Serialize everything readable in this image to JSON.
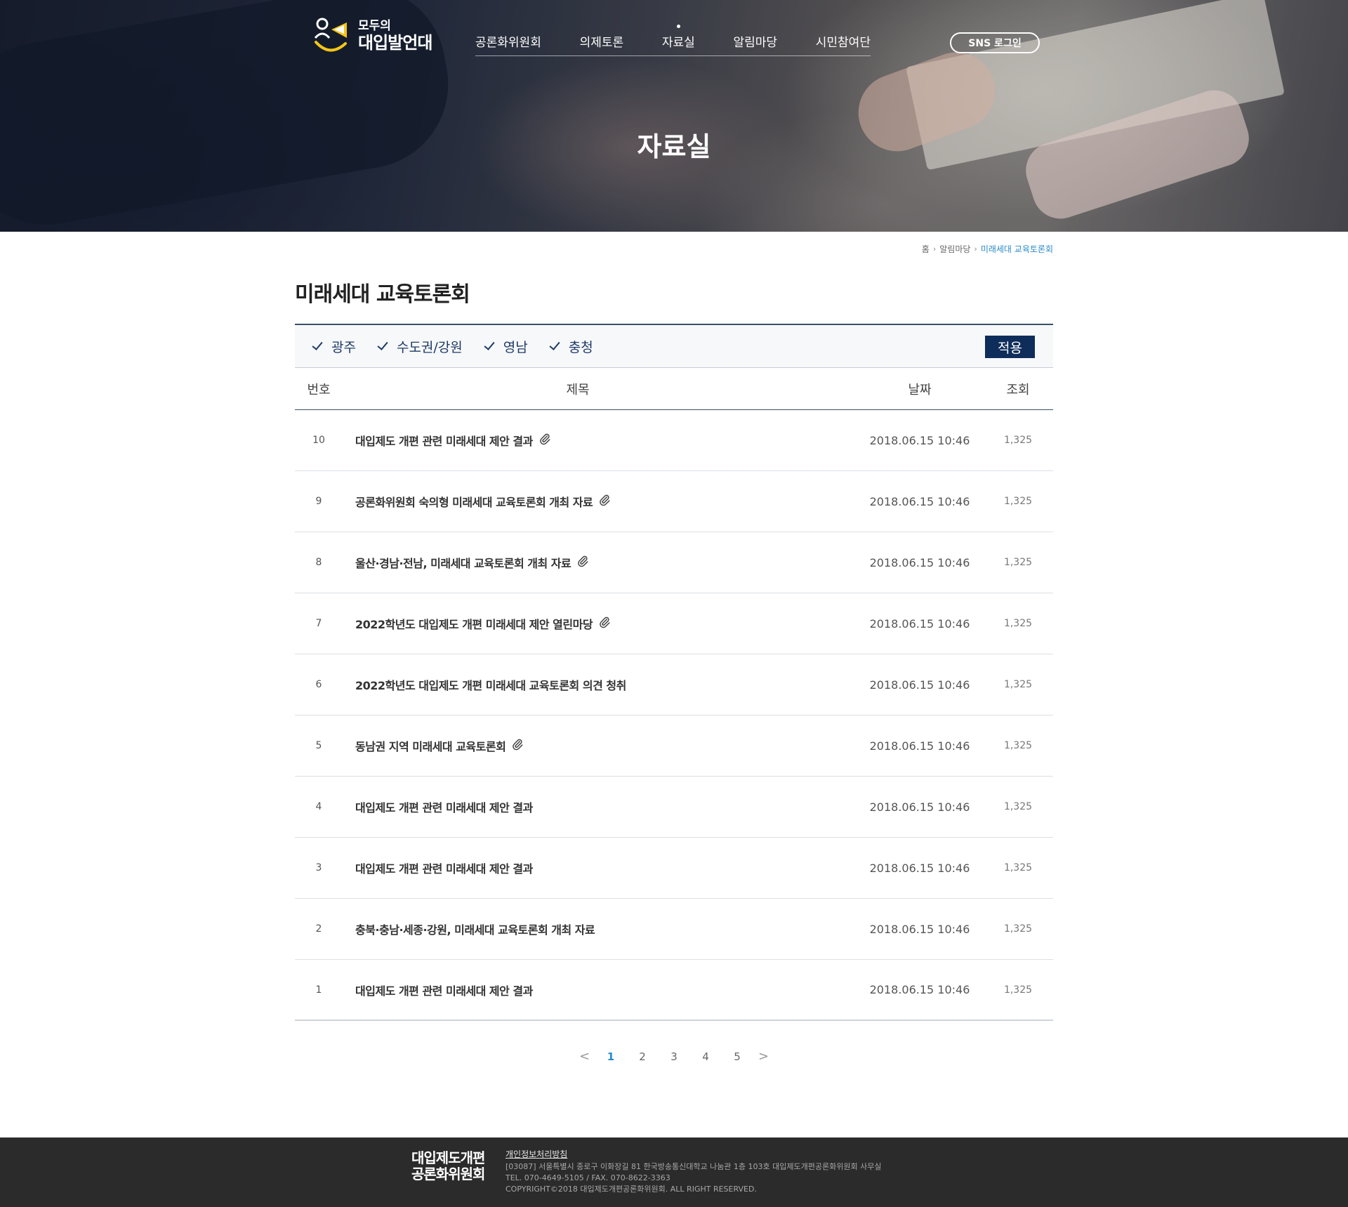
{
  "header": {
    "logo_small": "모두의",
    "logo_big": "대입발언대",
    "nav": [
      {
        "label": "공론화위원회"
      },
      {
        "label": "의제토론"
      },
      {
        "label": "자료실"
      },
      {
        "label": "알림마당"
      },
      {
        "label": "시민참여단"
      }
    ],
    "active_nav": "자료실",
    "sns_login": "SNS 로그인"
  },
  "hero": {
    "title": "자료실"
  },
  "breadcrumb": {
    "home": "홈",
    "level1": "알림마당",
    "current": "미래세대 교육토론회"
  },
  "page_title": "미래세대 교육토론회",
  "filters": {
    "options": [
      {
        "label": "광주",
        "checked": true
      },
      {
        "label": "수도권/강원",
        "checked": true
      },
      {
        "label": "영남",
        "checked": true
      },
      {
        "label": "충청",
        "checked": true
      }
    ],
    "apply": "적용"
  },
  "board": {
    "headers": {
      "num": "번호",
      "title": "제목",
      "date": "날짜",
      "views": "조회"
    },
    "rows": [
      {
        "num": "10",
        "title": "대입제도 개편 관련 미래세대 제안 결과",
        "attachment": true,
        "date": "2018.06.15  10:46",
        "views": "1,325"
      },
      {
        "num": "9",
        "title": "공론화위원회 숙의형 미래세대 교육토론회 개최 자료",
        "attachment": true,
        "date": "2018.06.15  10:46",
        "views": "1,325"
      },
      {
        "num": "8",
        "title": "울산·경남·전남, 미래세대 교육토론회 개최 자료",
        "attachment": true,
        "date": "2018.06.15  10:46",
        "views": "1,325"
      },
      {
        "num": "7",
        "title": "2022학년도 대입제도 개편 미래세대 제안 열린마당",
        "attachment": true,
        "date": "2018.06.15  10:46",
        "views": "1,325"
      },
      {
        "num": "6",
        "title": "2022학년도 대입제도 개편 미래세대 교육토론회 의견 청취",
        "attachment": false,
        "date": "2018.06.15  10:46",
        "views": "1,325"
      },
      {
        "num": "5",
        "title": "동남권 지역 미래세대 교육토론회",
        "attachment": true,
        "date": "2018.06.15  10:46",
        "views": "1,325"
      },
      {
        "num": "4",
        "title": "대입제도 개편 관련 미래세대 제안 결과",
        "attachment": false,
        "date": "2018.06.15  10:46",
        "views": "1,325"
      },
      {
        "num": "3",
        "title": "대입제도 개편 관련 미래세대 제안 결과",
        "attachment": false,
        "date": "2018.06.15  10:46",
        "views": "1,325"
      },
      {
        "num": "2",
        "title": "충북·충남·세종·강원, 미래세대 교육토론회 개최 자료",
        "attachment": false,
        "date": "2018.06.15  10:46",
        "views": "1,325"
      },
      {
        "num": "1",
        "title": "대입제도 개편 관련 미래세대 제안 결과",
        "attachment": false,
        "date": "2018.06.15  10:46",
        "views": "1,325"
      }
    ]
  },
  "pagination": {
    "prev": "<",
    "next": ">",
    "pages": [
      "1",
      "2",
      "3",
      "4",
      "5"
    ],
    "current": "1"
  },
  "footer": {
    "logo_line1": "대입제도개편",
    "logo_line2": "공론화위원회",
    "privacy": "개인정보처리방침",
    "address": "[03087] 서울특별시 종로구 이화장길 81 한국방송통신대학교 나눔관 1층 103호 대입제도개편공론화위원회 사무실",
    "contact": "TEL. 070-4649-5105 / FAX. 070-8622-3363",
    "copyright": "COPYRIGHT©2018 대입제도개편공론화위원회. ALL RIGHT RESERVED."
  },
  "colors": {
    "accent": "#2a8bc8",
    "navy": "#0e2d5a",
    "footer_bg": "#2b2b2b",
    "logo_yellow": "#f5c518"
  },
  "icons": [
    "logo-mark-icon",
    "check-icon",
    "paperclip-icon",
    "chevron-left-icon",
    "chevron-right-icon"
  ]
}
